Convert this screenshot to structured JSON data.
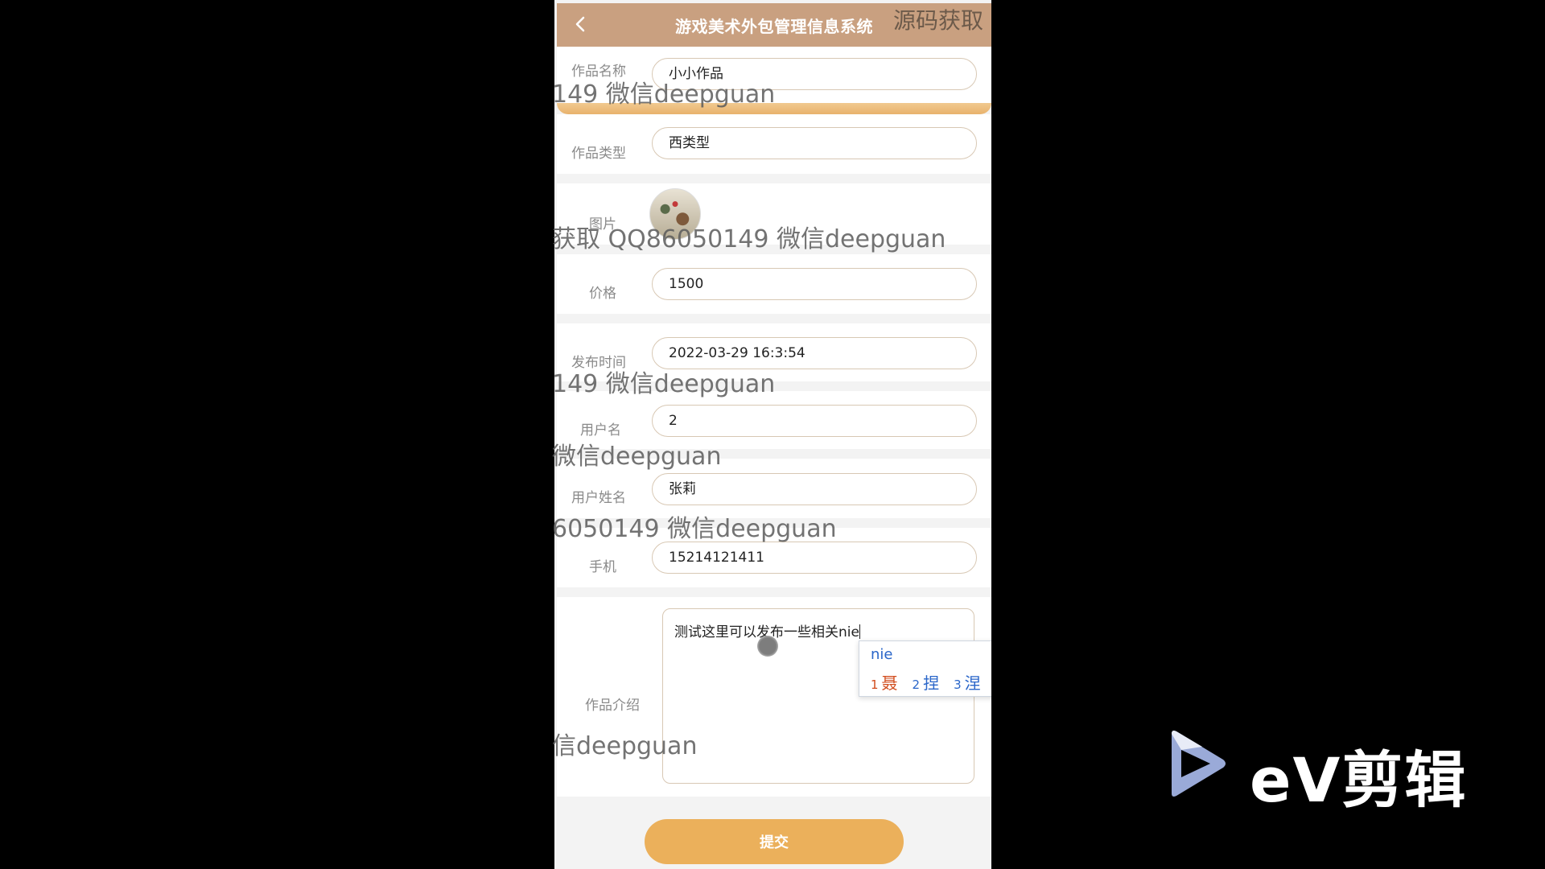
{
  "header": {
    "title": "游戏美术外包管理信息系统"
  },
  "watermarks": {
    "corner": "源码获取",
    "line1": "149 微信deepguan",
    "line2": "获取 QQ86050149 微信deepguan",
    "line3": "149 微信deepguan",
    "line4": "微信deepguan",
    "line5": "6050149 微信deepguan",
    "line6": "信deepguan"
  },
  "form": {
    "name": {
      "label": "作品名称",
      "value": "小小作品"
    },
    "type": {
      "label": "作品类型",
      "value": "西类型"
    },
    "image": {
      "label": "图片"
    },
    "price": {
      "label": "价格",
      "value": "1500"
    },
    "publish_time": {
      "label": "发布时间",
      "value": "2022-03-29 16:3:54"
    },
    "username": {
      "label": "用户名",
      "value": "2"
    },
    "realname": {
      "label": "用户姓名",
      "value": "张莉"
    },
    "phone": {
      "label": "手机",
      "value": "15214121411"
    },
    "intro": {
      "label": "作品介绍",
      "value": "测试这里可以发布一些相关nie"
    }
  },
  "ime": {
    "composition": "nie",
    "candidates": [
      {
        "num": "1",
        "char": "聂"
      },
      {
        "num": "2",
        "char": "捏"
      },
      {
        "num": "3",
        "char": "涅"
      }
    ]
  },
  "submit_label": "提交",
  "editor_logo": {
    "text": "eV剪辑",
    "icon": "play-icon"
  }
}
